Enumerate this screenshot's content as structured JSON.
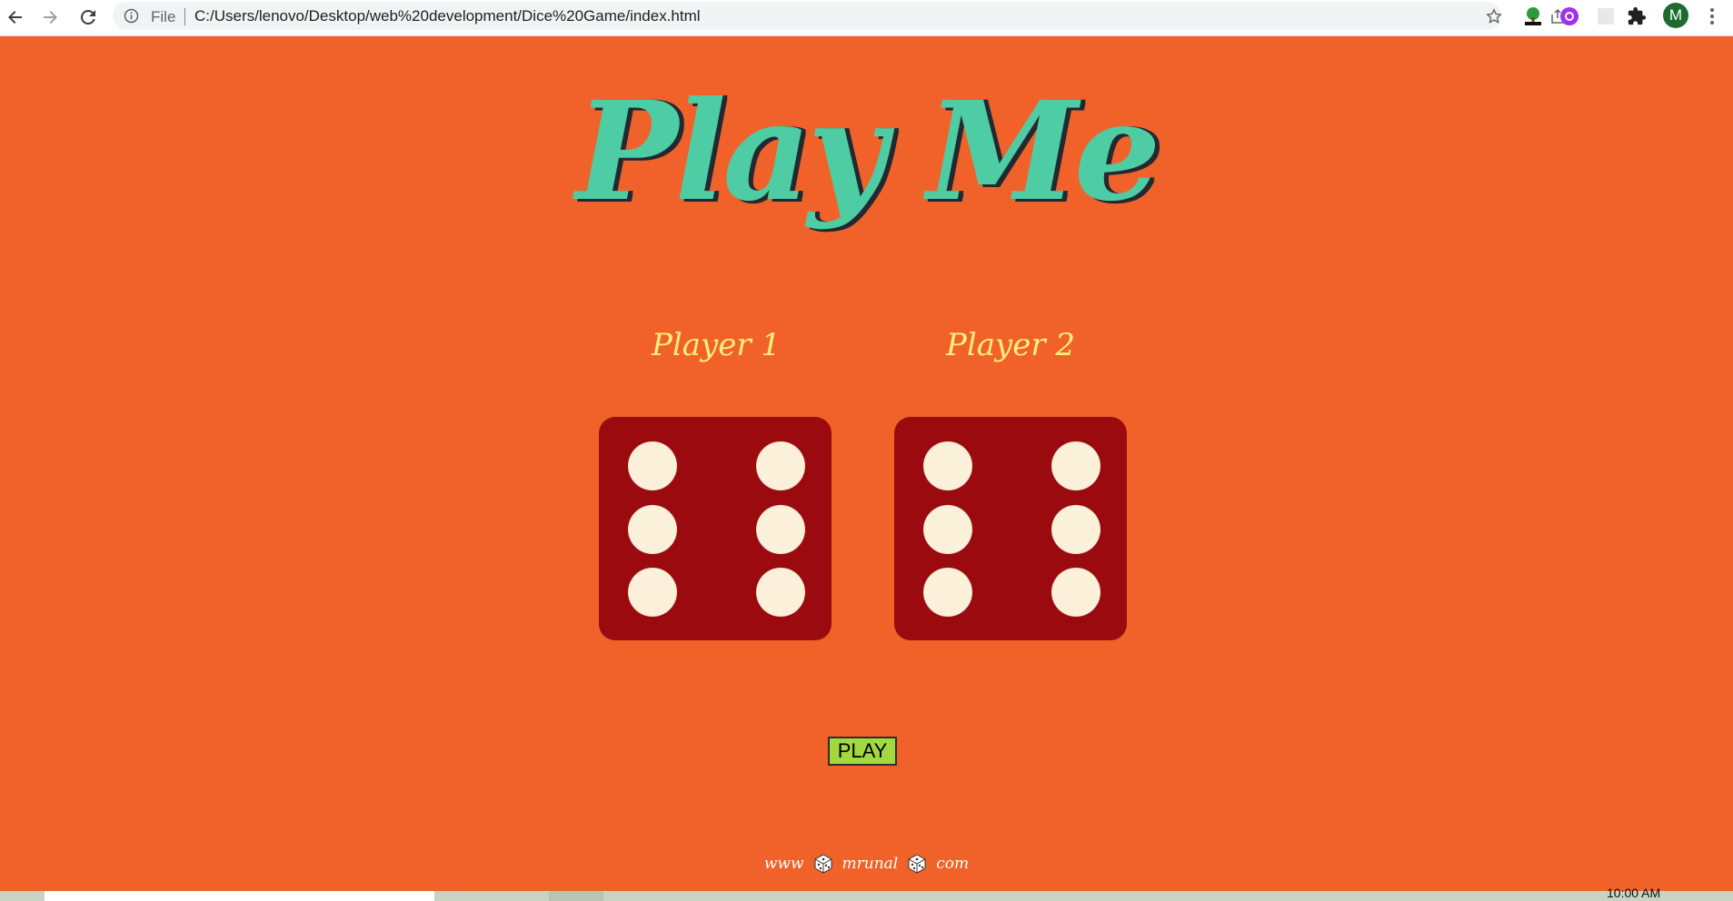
{
  "browser": {
    "nav": {
      "back_icon": "arrow-left-icon",
      "forward_icon": "arrow-right-icon",
      "reload_icon": "reload-icon"
    },
    "omnibox": {
      "info_icon": "info-icon",
      "scheme_label": "File",
      "url": "C:/Users/lenovo/Desktop/web%20development/Dice%20Game/index.html"
    },
    "extensions": [
      "share-icon",
      "star-icon",
      "html-tree-extension-icon",
      "purple-extension-icon",
      "blank-extension-icon",
      "puzzle-icon"
    ],
    "avatar_letter": "M",
    "colors": {
      "chrome": "#ffffff",
      "omnibox": "#f1f3f4",
      "avatar": "#1e6b2e"
    }
  },
  "page": {
    "title": "Play Me",
    "players": [
      {
        "label": "Player 1",
        "die_value": 6
      },
      {
        "label": "Player 2",
        "die_value": 6
      }
    ],
    "play_button": "PLAY",
    "footer": {
      "part1": "www",
      "part2": "mrunal",
      "part3": "com"
    },
    "colors": {
      "background": "#f1622a",
      "title": "#4ecca3",
      "title_shadow": "#232931",
      "player_label": "#fef079",
      "die": "#9a0a0e",
      "pip": "#fbf1da",
      "button": "#a3d93f"
    }
  },
  "taskbar": {
    "clock": "10:00 AM"
  }
}
